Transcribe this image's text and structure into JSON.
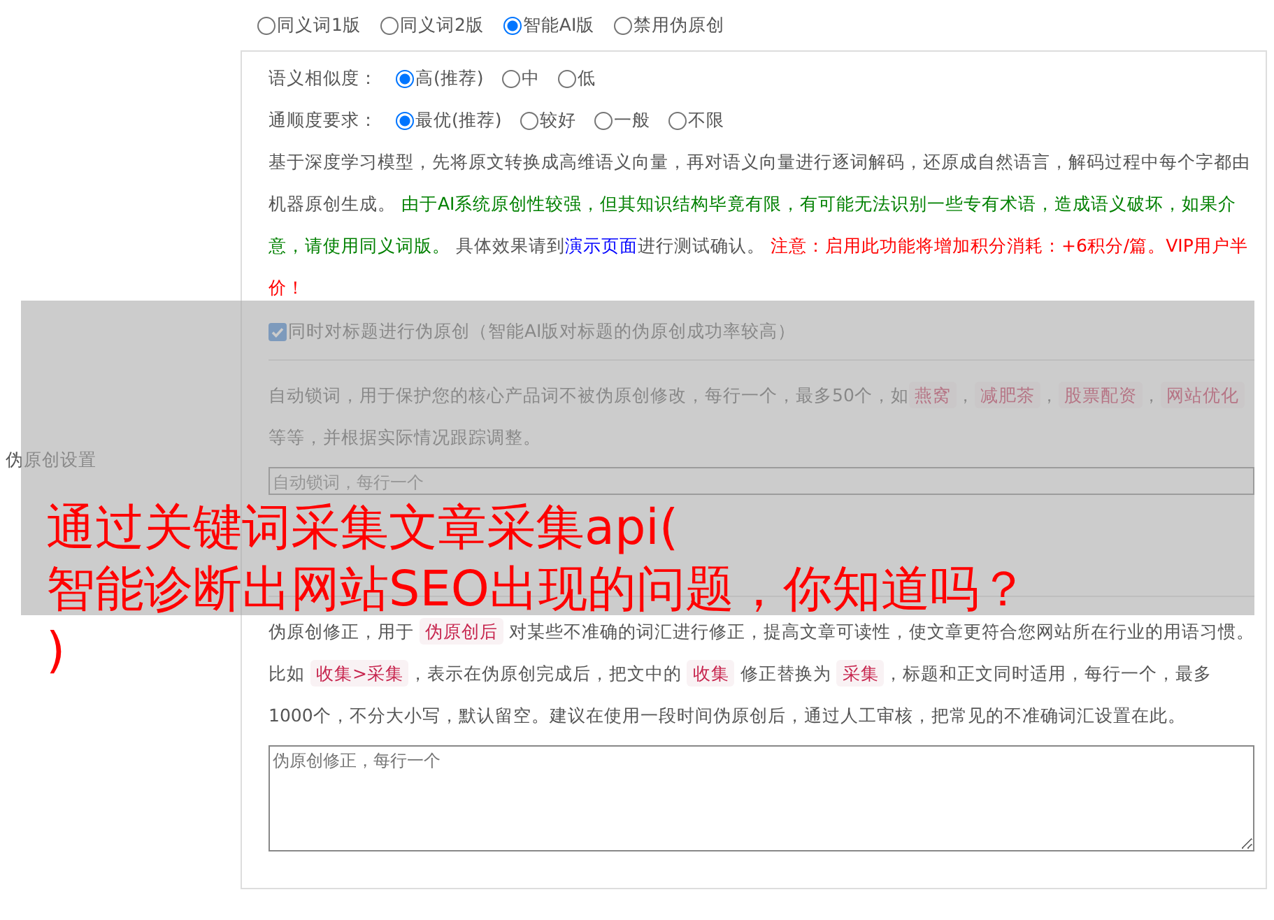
{
  "version_options": [
    {
      "label": "同义词1版",
      "selected": false
    },
    {
      "label": "同义词2版",
      "selected": false
    },
    {
      "label": "智能AI版",
      "selected": true
    },
    {
      "label": "禁用伪原创",
      "selected": false
    }
  ],
  "settings_label": "伪原创设置",
  "similarity": {
    "label": "语义相似度：",
    "options": [
      {
        "label": "高(推荐)",
        "selected": true
      },
      {
        "label": "中",
        "selected": false
      },
      {
        "label": "低",
        "selected": false
      }
    ]
  },
  "fluency": {
    "label": "通顺度要求：",
    "options": [
      {
        "label": "最优(推荐)",
        "selected": true
      },
      {
        "label": "较好",
        "selected": false
      },
      {
        "label": "一般",
        "selected": false
      },
      {
        "label": "不限",
        "selected": false
      }
    ]
  },
  "ai_description": [
    {
      "kind": "text",
      "text": "基于深度学习模型，先将原文转换成高维语义向量，再对语义向量进行逐词解码，还原成自然语言，解码过程中每个字都由机器原创生成。 "
    },
    {
      "kind": "notice",
      "text": "由于AI系统原创性较强，但其知识结构毕竟有限，有可能无法识别一些专有术语，造成语义破坏，如果介意，请使用同义词版。"
    },
    {
      "kind": "text",
      "text": " 具体效果请到"
    },
    {
      "kind": "link",
      "text": "演示页面"
    },
    {
      "kind": "text",
      "text": "进行测试确认。 "
    },
    {
      "kind": "warning",
      "text": "注意：启用此功能将增加积分消耗：+6积分/篇。VIP用户半价！"
    }
  ],
  "title_option": {
    "label": "同时对标题进行伪原创（智能AI版对标题的伪原创成功率较高）",
    "checked": true
  },
  "lock_words": {
    "description": [
      {
        "kind": "text",
        "text": "自动锁词，用于保护您的核心产品词不被伪原创修改，每行一个，最多50个，如"
      },
      {
        "kind": "tag",
        "text": "燕窝"
      },
      {
        "kind": "text",
        "text": "，"
      },
      {
        "kind": "tag",
        "text": "减肥茶"
      },
      {
        "kind": "text",
        "text": "，"
      },
      {
        "kind": "tag",
        "text": "股票配资"
      },
      {
        "kind": "text",
        "text": "，"
      },
      {
        "kind": "tag",
        "text": "网站优化"
      },
      {
        "kind": "text",
        "text": " 等等，并根据实际情况跟踪调整。"
      }
    ],
    "placeholder": "自动锁词，每行一个"
  },
  "correction": {
    "description": [
      {
        "kind": "text",
        "text": "伪原创修正，用于 "
      },
      {
        "kind": "tag",
        "text": "伪原创后"
      },
      {
        "kind": "text",
        "text": " 对某些不准确的词汇进行修正，提高文章可读性，使文章更符合您网站所在行业的用语习惯。比如 "
      },
      {
        "kind": "tag",
        "text": "收集>采集"
      },
      {
        "kind": "text",
        "text": "，表示在伪原创完成后，把文中的 "
      },
      {
        "kind": "tag",
        "text": "收集"
      },
      {
        "kind": "text",
        "text": " 修正替换为 "
      },
      {
        "kind": "tag",
        "text": "采集"
      },
      {
        "kind": "text",
        "text": "，标题和正文同时适用，每行一个，最多1000个，不分大小写，默认留空。建议在使用一段时间伪原创后，通过人工审核，把常见的不准确词汇设置在此。"
      }
    ],
    "placeholder": "伪原创修正，每行一个"
  },
  "overlay_title": [
    "通过关键词采集文章采集api(",
    "智能诊断出网站SEO出现的问题，你知道吗？",
    ")"
  ]
}
